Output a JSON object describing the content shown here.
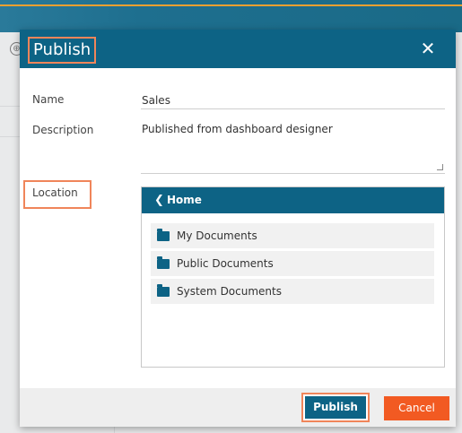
{
  "dialog": {
    "title": "Publish",
    "close_icon": "close-icon"
  },
  "form": {
    "name_label": "Name",
    "name_value": "Sales",
    "description_label": "Description",
    "description_value": "Published from dashboard designer",
    "location_label": "Location"
  },
  "location_browser": {
    "back_icon": "chevron-left-icon",
    "current": "Home",
    "folders": [
      {
        "label": "My Documents",
        "icon": "folder-icon"
      },
      {
        "label": "Public Documents",
        "icon": "folder-icon"
      },
      {
        "label": "System Documents",
        "icon": "folder-icon"
      }
    ]
  },
  "footer": {
    "publish_label": "Publish",
    "cancel_label": "Cancel"
  },
  "colors": {
    "header": "#0d6385",
    "highlight": "#f0855a",
    "cancel": "#f25a22",
    "footer_bg": "#eeeeee"
  }
}
